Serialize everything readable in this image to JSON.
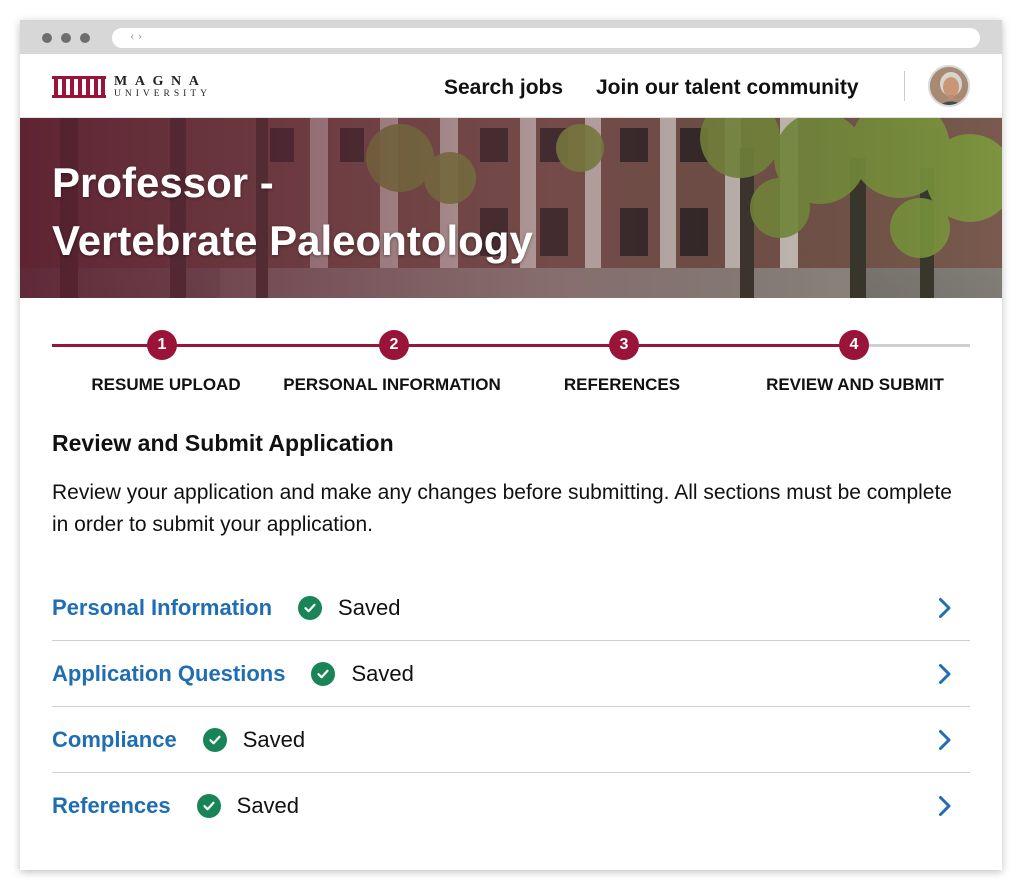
{
  "browser": {
    "nav_glyph": "‹ ›"
  },
  "logo": {
    "line1": "MAGNA",
    "line2": "UNIVERSITY",
    "brand_color": "#9a1439"
  },
  "nav": {
    "search_jobs": "Search jobs",
    "join": "Join our talent community"
  },
  "hero": {
    "title_line1": "Professor -",
    "title_line2": "Vertebrate Paleontology"
  },
  "stepper": {
    "accent": "#9a1439",
    "steps": [
      {
        "number": "1",
        "label": "RESUME UPLOAD"
      },
      {
        "number": "2",
        "label": "PERSONAL INFORMATION"
      },
      {
        "number": "3",
        "label": "REFERENCES"
      },
      {
        "number": "4",
        "label": "REVIEW AND SUBMIT"
      }
    ]
  },
  "review": {
    "title": "Review and Submit Application",
    "intro": "Review your application and make any changes before submitting. All sections must be complete in order to submit your application.",
    "sections": [
      {
        "label": "Personal Information",
        "status": "Saved",
        "status_icon": "check-circle-icon"
      },
      {
        "label": "Application Questions",
        "status": "Saved",
        "status_icon": "check-circle-icon"
      },
      {
        "label": "Compliance",
        "status": "Saved",
        "status_icon": "check-circle-icon"
      },
      {
        "label": "References",
        "status": "Saved",
        "status_icon": "check-circle-icon"
      }
    ],
    "link_color": "#1f6db3",
    "success_color": "#198457"
  }
}
